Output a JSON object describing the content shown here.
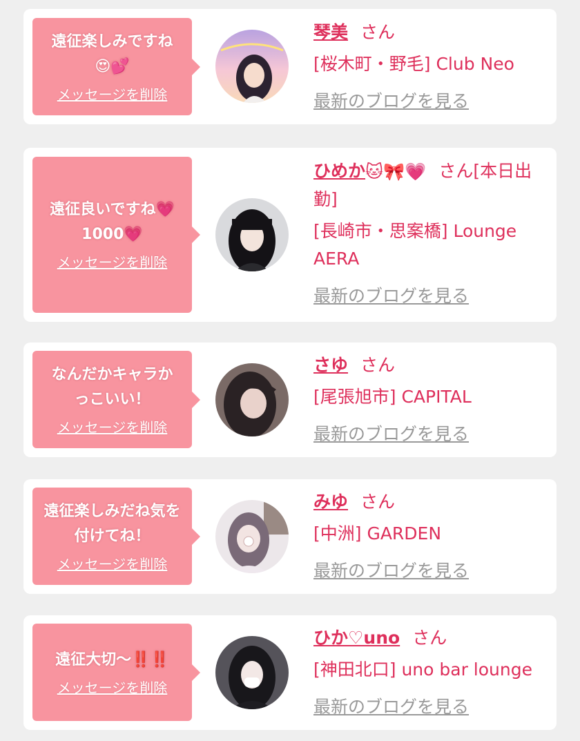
{
  "delete_label": "メッセージを削除",
  "blog_label": "最新のブログを見る",
  "san": "さん",
  "entries": [
    {
      "message": "遠征楽しみですね",
      "emoji": "😍💕",
      "name": "琴美",
      "store": "[桜木町・野毛] Club Neo",
      "avatar_icon": "girl-portrait-icon"
    },
    {
      "message": "遠征良いですね",
      "message_emoji": "💗",
      "message_line2": "1000",
      "message_line2_emoji": "💗",
      "name": "ひめか",
      "name_emoji": "🐱🎀💗",
      "name_suffix": "さん[本日出勤]",
      "store": "[長崎市・思案橋] Lounge AERA",
      "avatar_icon": "girl-portrait-icon"
    },
    {
      "message": "なんだかキャラかっこいい！",
      "name": "さゆ",
      "store": "[尾張旭市] CAPITAL",
      "avatar_icon": "girl-portrait-icon"
    },
    {
      "message": "遠征楽しみだね気を付けてね！",
      "name": "みゆ",
      "store": "[中洲] GARDEN",
      "avatar_icon": "girl-portrait-icon"
    },
    {
      "message": "遠征大切〜",
      "message_emoji": "‼️‼️",
      "name": "ひか♡uno",
      "store": "[神田北口] uno bar lounge",
      "avatar_icon": "girl-portrait-icon"
    }
  ],
  "colors": {
    "page_bg": "#efefef",
    "bubble": "#f8949f",
    "accent": "#de2f5b",
    "link_gray": "#999999"
  }
}
